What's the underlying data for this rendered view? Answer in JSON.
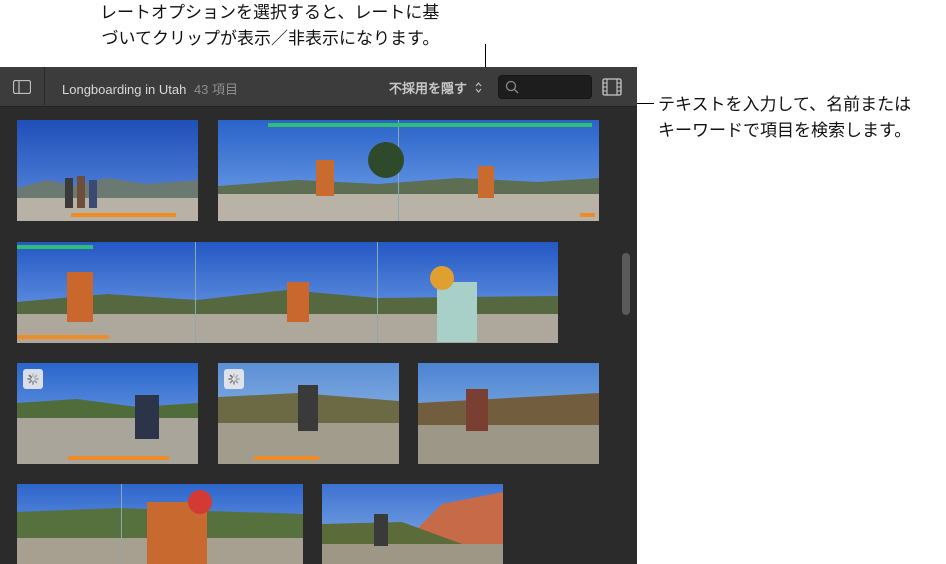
{
  "callouts": {
    "rating_line1": "レートオプションを選択すると、レートに基",
    "rating_line2": "づいてクリップが表示／非表示になります。",
    "search_line1": "テキストを入力して、名前または",
    "search_line2": "キーワードで項目を検索します。"
  },
  "toolbar": {
    "sidebar_toggle_icon": "sidebar-icon",
    "event_name": "Longboarding in Utah",
    "clip_count": "43 項目",
    "rating_filter": "不採用を隠す",
    "search_icon": "magnifier",
    "search_placeholder": "",
    "search_value": "",
    "filmstrip_icon": "filmstrip-icon"
  },
  "colors": {
    "favorite": "#2fbe74",
    "rejected": "#f08c26",
    "toolbar": "#3c3c3c",
    "background": "#2b2b2b"
  },
  "clips": [
    {
      "name": "clip-1",
      "favorite": [],
      "rejected": [
        [
          0.3,
          0.88
        ]
      ],
      "analyzing": false
    },
    {
      "name": "clip-2",
      "favorite": [
        [
          0.13,
          0.98
        ]
      ],
      "rejected": [
        [
          0.95,
          0.99
        ]
      ],
      "analyzing": false
    },
    {
      "name": "clip-3",
      "favorite": [
        [
          0.0,
          0.14
        ]
      ],
      "rejected": [
        [
          0.0,
          0.17
        ]
      ],
      "analyzing": false
    },
    {
      "name": "clip-4",
      "favorite": [],
      "rejected": [
        [
          0.28,
          0.84
        ]
      ],
      "analyzing": true
    },
    {
      "name": "clip-5",
      "favorite": [],
      "rejected": [
        [
          0.2,
          0.56
        ]
      ],
      "analyzing": true
    },
    {
      "name": "clip-6",
      "favorite": [],
      "rejected": [],
      "analyzing": false
    },
    {
      "name": "clip-7",
      "favorite": [],
      "rejected": [],
      "analyzing": false
    },
    {
      "name": "clip-8",
      "favorite": [],
      "rejected": [],
      "analyzing": false
    }
  ]
}
